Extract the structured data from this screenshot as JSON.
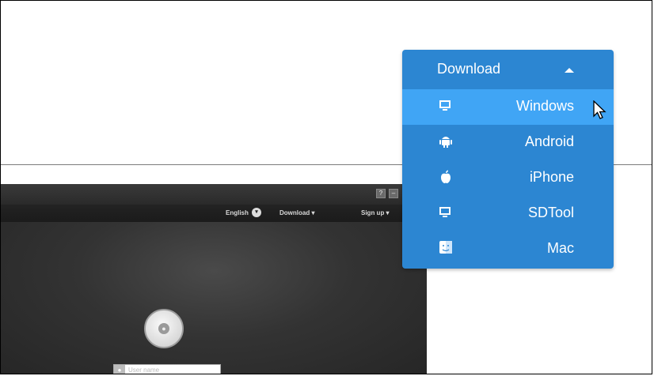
{
  "app": {
    "titlebar_buttons": [
      "?",
      "–"
    ],
    "menu": {
      "language": "English",
      "download": "Download ▾",
      "signup": "Sign up ▾"
    },
    "login": {
      "username_placeholder": "User name"
    }
  },
  "dropdown": {
    "title": "Download",
    "items": [
      {
        "label": "Windows",
        "icon": "monitor-icon",
        "active": true
      },
      {
        "label": "Android",
        "icon": "android-icon",
        "active": false
      },
      {
        "label": "iPhone",
        "icon": "apple-icon",
        "active": false
      },
      {
        "label": "SDTool",
        "icon": "monitor-icon",
        "active": false
      },
      {
        "label": "Mac",
        "icon": "finder-icon",
        "active": false
      }
    ]
  },
  "colors": {
    "dropdown_bg": "#2c86d2",
    "dropdown_active": "#40a5f5"
  }
}
